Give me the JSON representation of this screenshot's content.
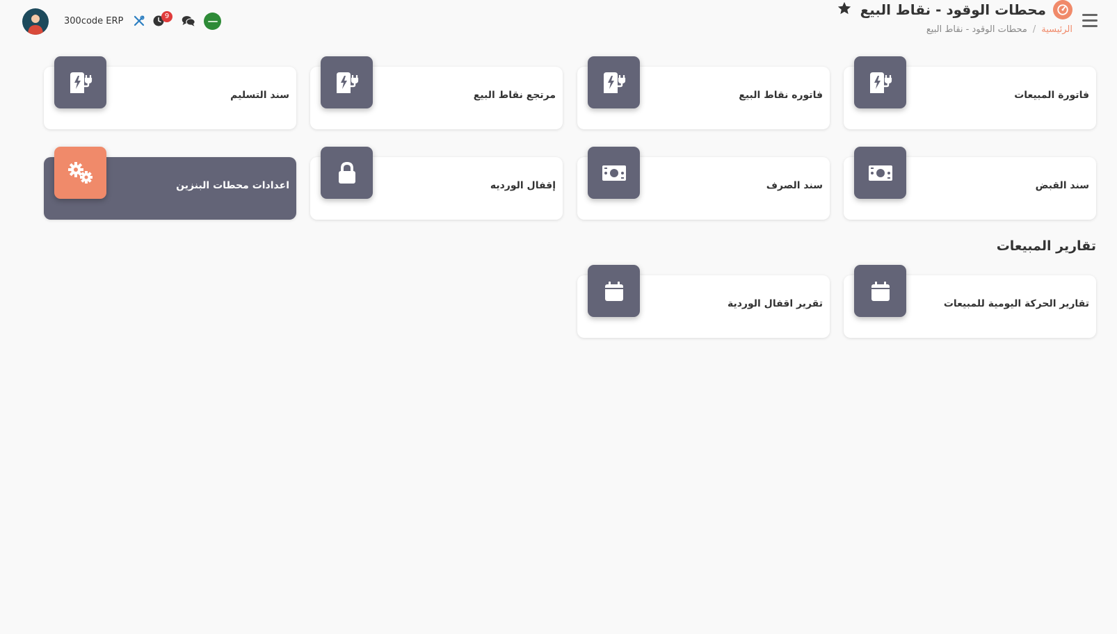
{
  "header": {
    "title": "محطات الوقود - نقاط البيع",
    "breadcrumb": {
      "home": "الرئيسية",
      "separator": "/",
      "current": "محطات الوقود - نقاط البيع"
    },
    "app_name": "300code ERP",
    "notification_count": "9"
  },
  "colors": {
    "accent": "#f08a6a",
    "tile": "#636477",
    "badge": "#e03b3b",
    "tools": "#2d7fc1"
  },
  "cards": [
    {
      "label": "فاتورة المبيعات",
      "icon": "fuel-pump-icon"
    },
    {
      "label": "فاتوره نقاط البيع",
      "icon": "fuel-pump-icon"
    },
    {
      "label": "مرتجع نقاط البيع",
      "icon": "fuel-pump-icon"
    },
    {
      "label": "سند التسليم",
      "icon": "fuel-pump-icon"
    },
    {
      "label": "سند القبض",
      "icon": "money-bill-icon"
    },
    {
      "label": "سند الصرف",
      "icon": "money-bill-icon"
    },
    {
      "label": "إقفال الورديه",
      "icon": "lock-icon"
    },
    {
      "label": "اعدادات محطات البنزين",
      "icon": "gears-icon"
    }
  ],
  "reports": {
    "title": "تقارير المبيعات",
    "cards": [
      {
        "label": "تقارير الحركة اليومية للمبيعات",
        "icon": "calendar-icon"
      },
      {
        "label": "تقرير اقفال الوردية",
        "icon": "calendar-icon"
      }
    ]
  }
}
